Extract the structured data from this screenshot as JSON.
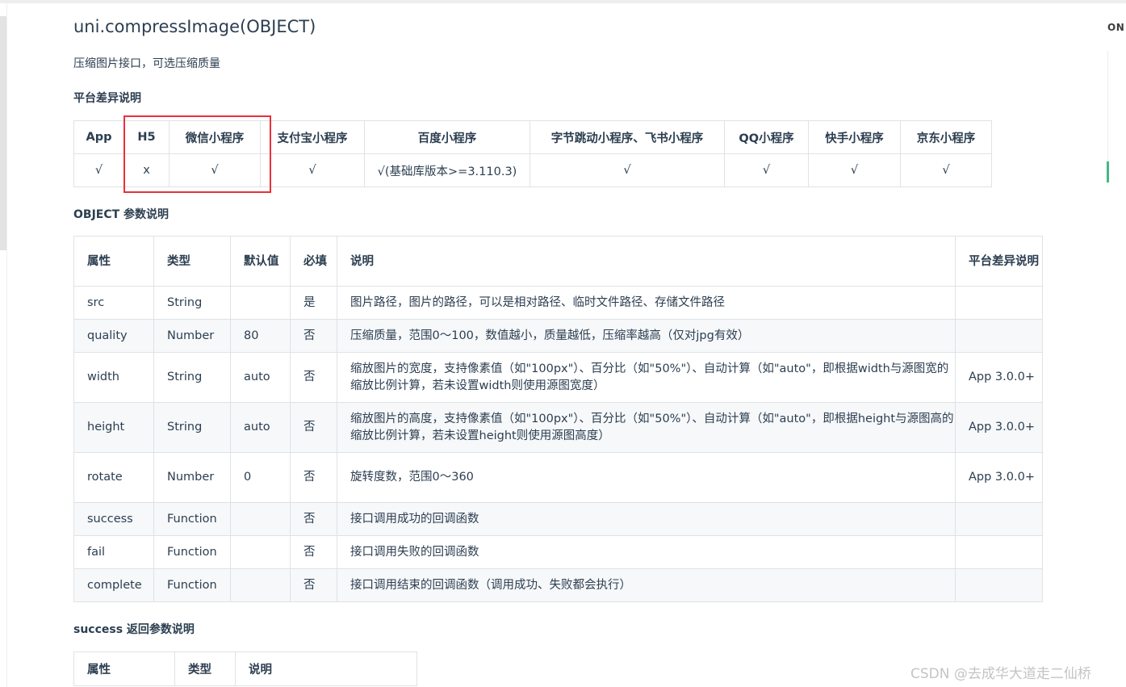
{
  "api": {
    "title": "uni.compressImage(OBJECT)",
    "description": "压缩图片接口，可选压缩质量"
  },
  "toc": {
    "label": "ON"
  },
  "platform_section": {
    "title": "平台差异说明",
    "headers": [
      "App",
      "H5",
      "微信小程序",
      "支付宝小程序",
      "百度小程序",
      "字节跳动小程序、飞书小程序",
      "QQ小程序",
      "快手小程序",
      "京东小程序"
    ],
    "values": [
      "√",
      "x",
      "√",
      "√",
      "√(基础库版本>=3.110.3)",
      "√",
      "√",
      "√",
      "√"
    ]
  },
  "params_section": {
    "title": "OBJECT 参数说明",
    "headers": [
      "属性",
      "类型",
      "默认值",
      "必填",
      "说明",
      "平台差异说明"
    ],
    "rows": [
      [
        "src",
        "String",
        "",
        "是",
        "图片路径，图片的路径，可以是相对路径、临时文件路径、存储文件路径",
        ""
      ],
      [
        "quality",
        "Number",
        "80",
        "否",
        "压缩质量，范围0～100，数值越小，质量越低，压缩率越高（仅对jpg有效）",
        ""
      ],
      [
        "width",
        "String",
        "auto",
        "否",
        "缩放图片的宽度，支持像素值（如\"100px\"）、百分比（如\"50%\"）、自动计算（如\"auto\"，即根据width与源图宽的缩放比例计算，若未设置width则使用源图宽度）",
        "App 3.0.0+"
      ],
      [
        "height",
        "String",
        "auto",
        "否",
        "缩放图片的高度，支持像素值（如\"100px\"）、百分比（如\"50%\"）、自动计算（如\"auto\"，即根据height与源图高的缩放比例计算，若未设置height则使用源图高度）",
        "App 3.0.0+"
      ],
      [
        "rotate",
        "Number",
        "0",
        "否",
        "旋转度数，范围0～360",
        "App 3.0.0+"
      ],
      [
        "success",
        "Function",
        "",
        "否",
        "接口调用成功的回调函数",
        ""
      ],
      [
        "fail",
        "Function",
        "",
        "否",
        "接口调用失败的回调函数",
        ""
      ],
      [
        "complete",
        "Function",
        "",
        "否",
        "接口调用结束的回调函数（调用成功、失败都会执行）",
        ""
      ]
    ]
  },
  "success_section": {
    "title": "success 返回参数说明",
    "headers": [
      "属性",
      "类型",
      "说明"
    ]
  },
  "watermark": "CSDN @去成华大道走二仙桥",
  "colors": {
    "highlight_box": "#e8303a",
    "toc_active": "#42b983",
    "text": "#2c3e50",
    "border": "#dfe2e5",
    "stripe": "#f6f8fa"
  }
}
